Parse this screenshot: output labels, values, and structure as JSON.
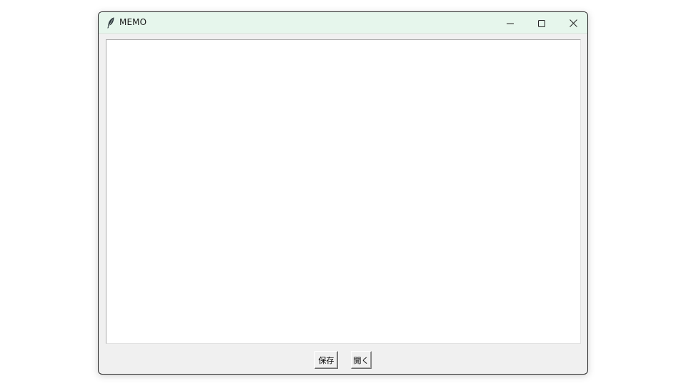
{
  "window": {
    "title": "MEMO",
    "app_icon": "feather-icon",
    "controls": {
      "minimize_icon": "minimize-icon",
      "maximize_icon": "maximize-icon",
      "close_icon": "close-icon"
    }
  },
  "editor": {
    "value": ""
  },
  "buttons": {
    "save_label": "保存",
    "open_label": "開く"
  },
  "colors": {
    "titlebar": "#e6f6ec",
    "window_bg": "#f0f0f0",
    "editor_bg": "#ffffff"
  }
}
